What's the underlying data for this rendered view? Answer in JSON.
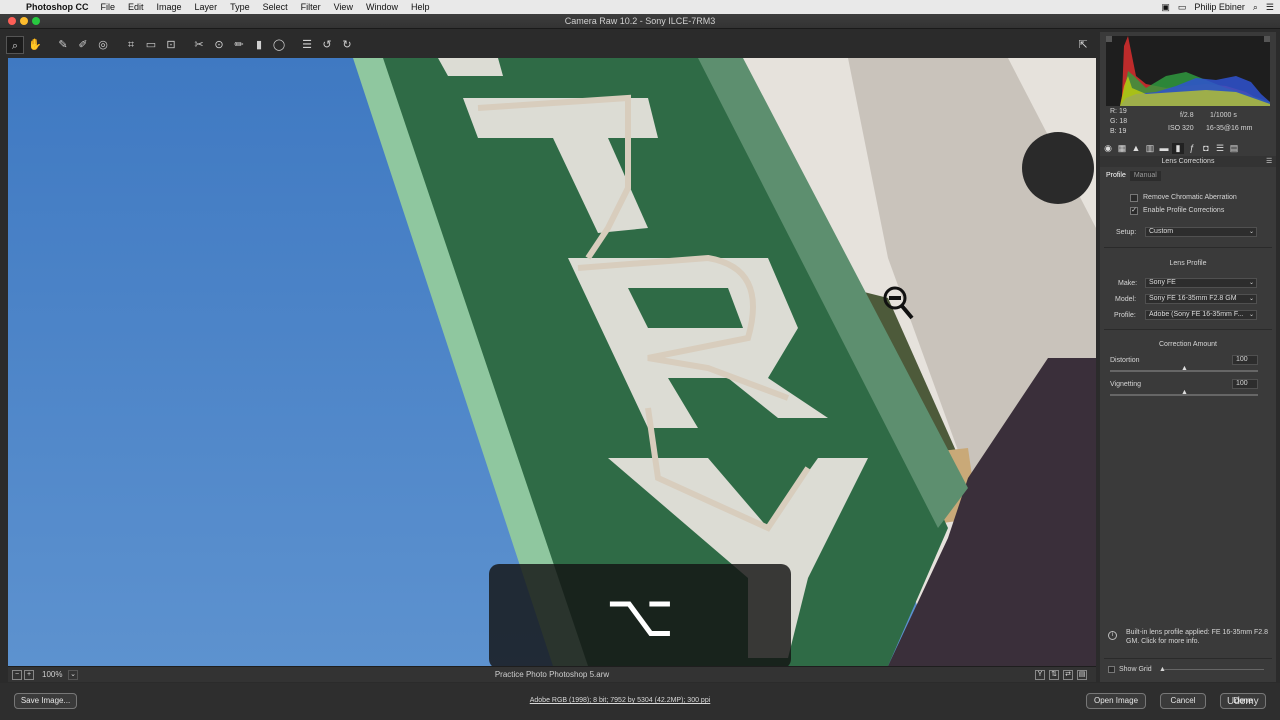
{
  "menubar": {
    "app_name": "Photoshop CC",
    "menus": [
      "File",
      "Edit",
      "Image",
      "Layer",
      "Type",
      "Select",
      "Filter",
      "View",
      "Window",
      "Help"
    ],
    "user_name": "Philip Ebiner"
  },
  "window": {
    "title": "Camera Raw 10.2  -  Sony ILCE-7RM3"
  },
  "toolbar": {
    "tools": [
      {
        "name": "zoom-tool",
        "glyph": "⌕"
      },
      {
        "name": "hand-tool",
        "glyph": "✋"
      },
      {
        "name": "white-balance-tool",
        "glyph": "✎"
      },
      {
        "name": "color-sampler-tool",
        "glyph": "✐"
      },
      {
        "name": "targeted-adjustment-tool",
        "glyph": "◎"
      },
      {
        "name": "crop-tool",
        "glyph": "⌗"
      },
      {
        "name": "straighten-tool",
        "glyph": "▭"
      },
      {
        "name": "transform-tool",
        "glyph": "⊡"
      },
      {
        "name": "spot-removal-tool",
        "glyph": "✂"
      },
      {
        "name": "red-eye-tool",
        "glyph": "⊙"
      },
      {
        "name": "adjustment-brush-tool",
        "glyph": "✏"
      },
      {
        "name": "graduated-filter-tool",
        "glyph": "▮"
      },
      {
        "name": "radial-filter-tool",
        "glyph": "◯"
      },
      {
        "name": "preferences-tool",
        "glyph": "☰"
      },
      {
        "name": "rotate-left-tool",
        "glyph": "↺"
      },
      {
        "name": "rotate-right-tool",
        "glyph": "↻"
      }
    ]
  },
  "overlay": {
    "key_symbol": "⌥"
  },
  "status": {
    "zoom": "100%",
    "filename": "Practice Photo Photoshop 5.arw"
  },
  "readout": {
    "r": "R:   19",
    "g": "G:   18",
    "b": "B:   19",
    "aperture": "f/2.8",
    "shutter": "1/1000 s",
    "iso": "ISO 320",
    "lens": "16-35@16 mm"
  },
  "panel": {
    "section_title": "Lens Corrections",
    "subtabs": [
      "Profile",
      "Manual"
    ],
    "remove_ca_label": "Remove Chromatic Aberration",
    "enable_profile_label": "Enable Profile Corrections",
    "setup_label": "Setup:",
    "setup_value": "Custom",
    "lens_profile_header": "Lens Profile",
    "make_label": "Make:",
    "make_value": "Sony FE",
    "model_label": "Model:",
    "model_value": "Sony FE 16-35mm F2.8 GM",
    "profile_label": "Profile:",
    "profile_value": "Adobe (Sony FE 16-35mm F...",
    "correction_header": "Correction Amount",
    "distortion_label": "Distortion",
    "distortion_value": "100",
    "vignetting_label": "Vignetting",
    "vignetting_value": "100",
    "info_note": "Built-in lens profile applied: FE 16-35mm F2.8 GM.  Click for more info.",
    "show_grid_label": "Show Grid"
  },
  "bottombar": {
    "save_label": "Save Image...",
    "workflow_text": "Adobe RGB (1998); 8 bit; 7952 by 5304 (42.2MP); 300 ppi",
    "open_label": "Open Image",
    "cancel_label": "Cancel",
    "done_label": "Done",
    "watermark": "Udemy"
  },
  "colors": {
    "sky": "#4d83c4",
    "sign_green": "#2f6b46",
    "sign_edge": "#9fd3ad",
    "panel_bg": "#3a3a3a"
  }
}
